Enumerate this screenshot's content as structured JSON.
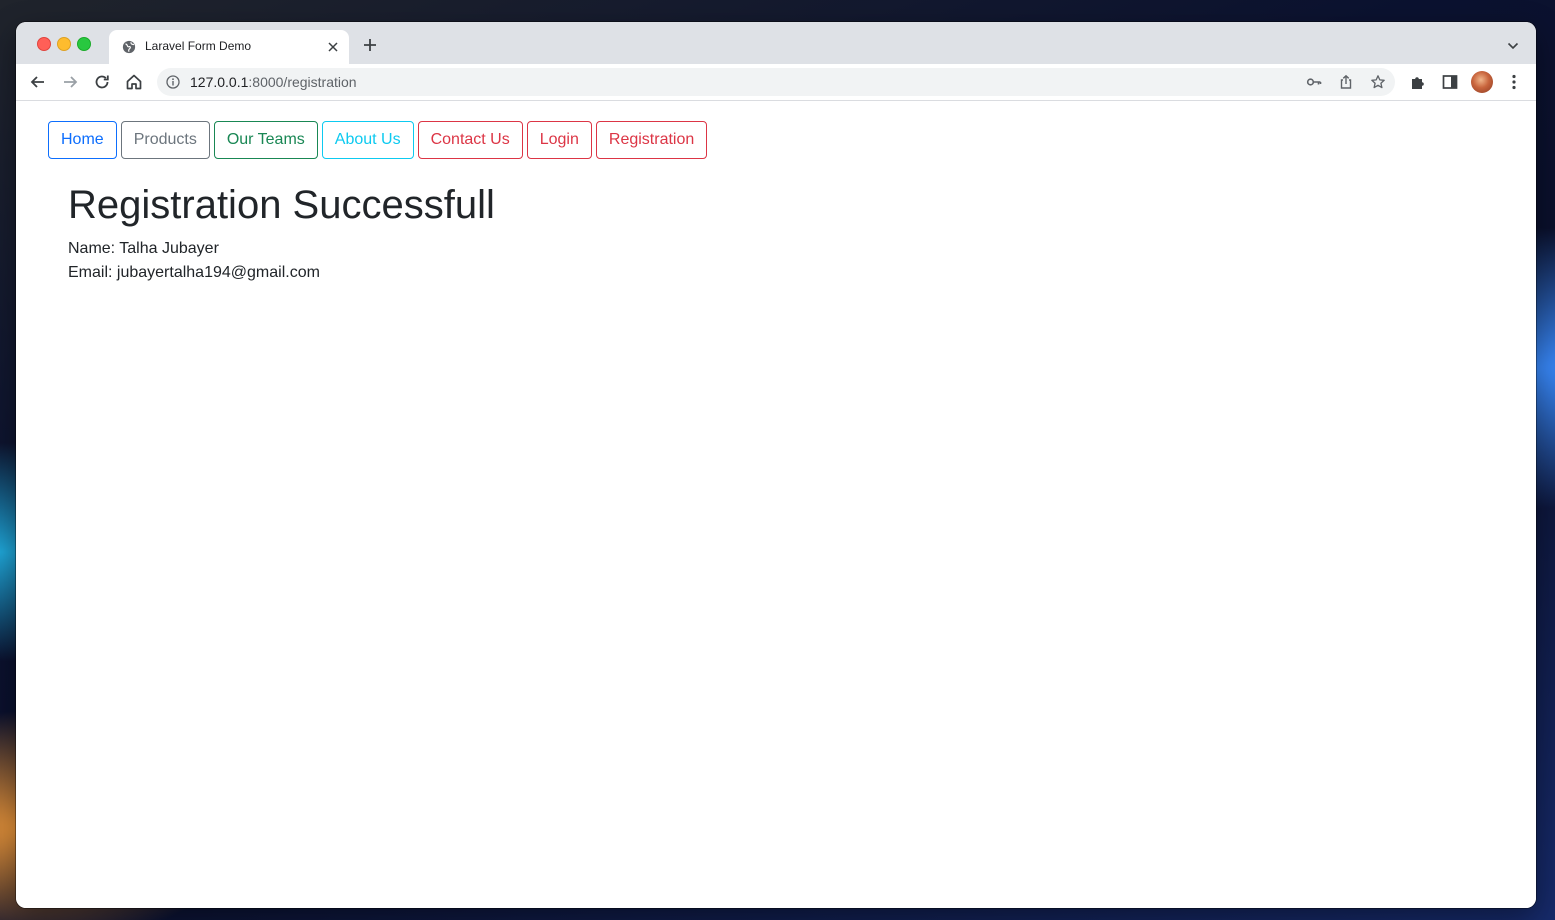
{
  "browser": {
    "tab_title": "Laravel Form Demo",
    "url_host": "127.0.0.1",
    "url_path": ":8000/registration"
  },
  "nav": {
    "buttons": [
      {
        "label": "Home",
        "color": "#0d6efd"
      },
      {
        "label": "Products",
        "color": "#6c757d"
      },
      {
        "label": "Our Teams",
        "color": "#198754"
      },
      {
        "label": "About Us",
        "color": "#0dcaf0"
      },
      {
        "label": "Contact Us",
        "color": "#dc3545"
      },
      {
        "label": "Login",
        "color": "#dc3545"
      },
      {
        "label": "Registration",
        "color": "#dc3545"
      }
    ]
  },
  "main": {
    "heading": "Registration Successfull",
    "name_label": "Name:",
    "name_value": "Talha Jubayer",
    "email_label": "Email:",
    "email_value": "jubayertalha194@gmail.com"
  }
}
